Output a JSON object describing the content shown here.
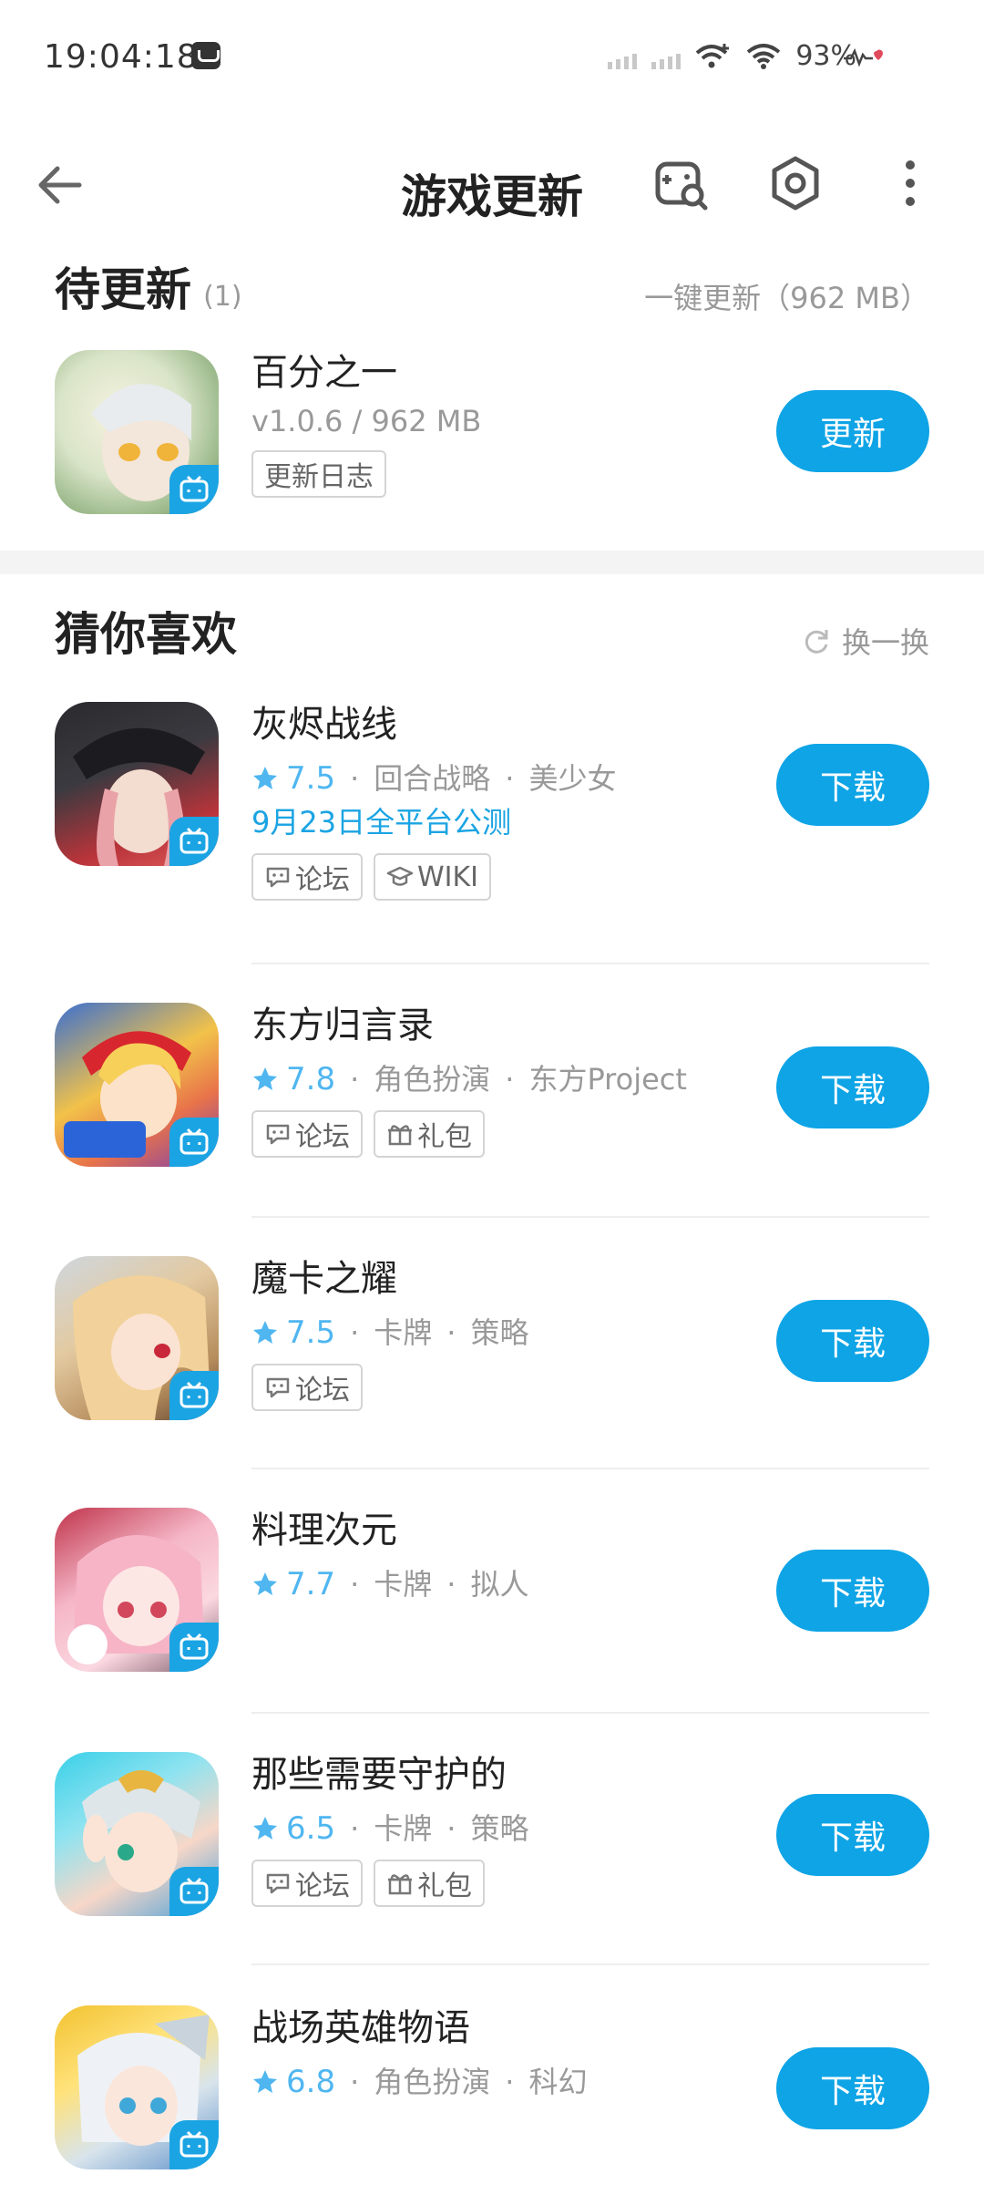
{
  "status_bar": {
    "time": "19:04:18",
    "battery": "93%"
  },
  "header": {
    "title": "游戏更新"
  },
  "pending": {
    "title": "待更新",
    "count": "(1)",
    "update_all": "一键更新（962 MB）",
    "app": {
      "name": "百分之一",
      "version_size": "v1.0.6 /  962 MB",
      "changelog": "更新日志",
      "button": "更新"
    }
  },
  "recommend": {
    "title": "猜你喜欢",
    "refresh": "换一换",
    "apps": [
      {
        "name": "灰烬战线",
        "rating": "7.5",
        "tags": [
          "回合战略",
          "美少女"
        ],
        "promo": "9月23日全平台公测",
        "chips": [
          "论坛",
          "WIKI"
        ],
        "button": "下载"
      },
      {
        "name": "东方归言录",
        "rating": "7.8",
        "tags": [
          "角色扮演",
          "东方Project"
        ],
        "chips": [
          "论坛",
          "礼包"
        ],
        "button": "下载"
      },
      {
        "name": "魔卡之耀",
        "rating": "7.5",
        "tags": [
          "卡牌",
          "策略"
        ],
        "chips": [
          "论坛"
        ],
        "button": "下载"
      },
      {
        "name": "料理次元",
        "rating": "7.7",
        "tags": [
          "卡牌",
          "拟人"
        ],
        "button": "下载"
      },
      {
        "name": "那些需要守护的",
        "rating": "6.5",
        "tags": [
          "卡牌",
          "策略"
        ],
        "chips": [
          "论坛",
          "礼包"
        ],
        "button": "下载"
      },
      {
        "name": "战场英雄物语",
        "rating": "6.8",
        "tags": [
          "角色扮演",
          "科幻"
        ],
        "button": "下载"
      }
    ]
  },
  "colors": {
    "accent": "#0ea4e6",
    "rating": "#4fb6f0",
    "badge": "#1ba4e3"
  },
  "icons": [
    "back-arrow-icon",
    "game-search-icon",
    "settings-hexagon-icon",
    "more-vertical-icon",
    "refresh-icon",
    "star-icon",
    "forum-icon",
    "wiki-icon",
    "gift-icon",
    "bilibili-tv-icon"
  ]
}
